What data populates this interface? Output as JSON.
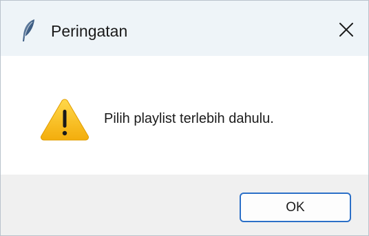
{
  "window": {
    "title": "Peringatan",
    "app_icon": "feather-icon",
    "close_icon": "close-icon"
  },
  "dialog": {
    "icon": "warning-icon",
    "message": "Pilih playlist terlebih dahulu.",
    "ok_label": "OK"
  },
  "colors": {
    "titlebar_bg": "#eef4f8",
    "footer_bg": "#f0f0f0",
    "button_border": "#2b6fc7",
    "warning_fill": "#f7c21b"
  }
}
